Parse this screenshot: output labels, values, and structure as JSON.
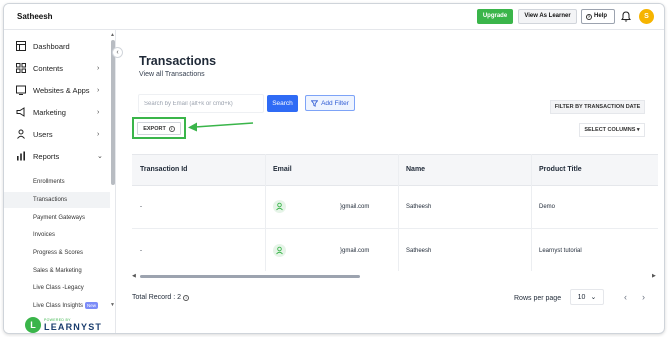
{
  "header": {
    "brand": "Satheesh",
    "upgrade_label": "Upgrade",
    "view_as_learner_label": "View As Learner",
    "help_label": "Help",
    "avatar_initial": "S",
    "accent_color": "#3ab54a"
  },
  "sidebar": {
    "items": [
      {
        "label": "Dashboard",
        "icon": "dashboard-icon"
      },
      {
        "label": "Contents",
        "icon": "contents-icon",
        "chevron": "›"
      },
      {
        "label": "Websites & Apps",
        "icon": "websites-icon",
        "chevron": "›"
      },
      {
        "label": "Marketing",
        "icon": "marketing-icon",
        "chevron": "›"
      },
      {
        "label": "Users",
        "icon": "users-icon",
        "chevron": "›"
      },
      {
        "label": "Reports",
        "icon": "reports-icon",
        "chevron": "⌄"
      }
    ],
    "subitems": [
      {
        "label": "Enrollments"
      },
      {
        "label": "Transactions"
      },
      {
        "label": "Payment Gateways"
      },
      {
        "label": "Invoices"
      },
      {
        "label": "Progress & Scores"
      },
      {
        "label": "Sales & Marketing"
      },
      {
        "label": "Live Class -Legacy"
      },
      {
        "label": "Live Class Insights"
      }
    ],
    "new_badge": "New",
    "logo_small": "POWERED BY",
    "logo_big": "LEARNYST"
  },
  "main": {
    "title": "Transactions",
    "subtitle": "View all Transactions",
    "search_placeholder": "Search by Email (alt+k or cmd+k)",
    "search_label": "Search",
    "add_filter_label": "Add Filter",
    "export_label": "EXPORT",
    "filter_by_date_label": "FILTER BY TRANSACTION DATE",
    "select_columns_label": "SELECT COLUMNS",
    "table": {
      "columns": [
        "Transaction Id",
        "Email",
        "Name",
        "Product Title"
      ],
      "rows": [
        {
          "id": "-",
          "email": "}gmail.com",
          "name": "Satheesh",
          "product": "Demo"
        },
        {
          "id": "-",
          "email": "}gmail.com",
          "name": "Satheesh",
          "product": "Learnyst tutorial"
        }
      ]
    },
    "total_record": "Total Record : 2",
    "rows_per_page_label": "Rows per page",
    "rows_per_page_value": "10"
  }
}
